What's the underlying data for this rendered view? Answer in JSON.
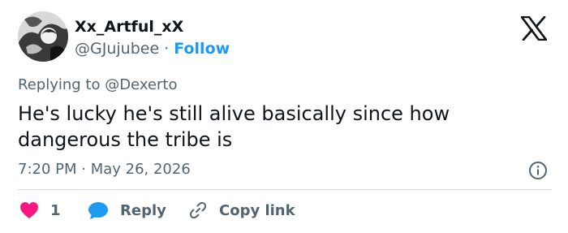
{
  "user": {
    "display_name": "Xx_Artful_xX",
    "handle": "@GJujubee",
    "separator": "·",
    "follow_label": "Follow"
  },
  "replying_to": "Replying to @Dexerto",
  "tweet": {
    "text": "He's lucky he's still alive basically since how dangerous the tribe is",
    "timestamp": "7:20 PM · May 26, 2026"
  },
  "actions": {
    "like_count": "1",
    "reply_label": "Reply",
    "copy_label": "Copy link"
  },
  "icons": {
    "logo": "x-logo-icon",
    "info": "info-icon",
    "like": "heart-icon",
    "reply": "speech-bubble-icon",
    "copy": "link-icon"
  },
  "colors": {
    "follow": "#1d9bf0",
    "heart": "#f91880",
    "reply_bubble": "#1d9bf0",
    "secondary_text": "#536471",
    "primary_text": "#0f1419",
    "divider": "#cfd9de"
  }
}
